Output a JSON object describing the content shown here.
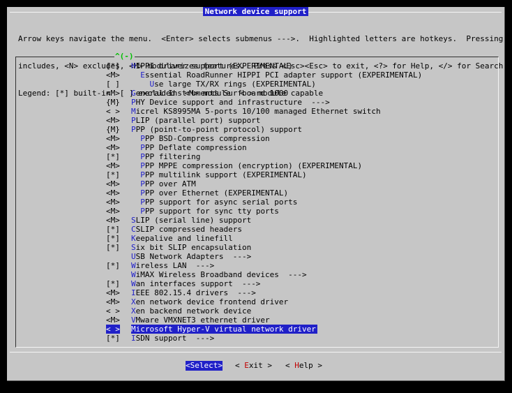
{
  "title": "Network device support",
  "help": [
    "Arrow keys navigate the menu.  <Enter> selects submenus --->.  Highlighted letters are hotkeys.  Pressing <Y>",
    "includes, <N> excludes, <M> modularizes features.  Press <Esc><Esc> to exit, <?> for Help, </> for Search.",
    "Legend: [*] built-in  [ ] excluded  <M> module  < > module capable"
  ],
  "scroll_indicator": "^(-)",
  "items": [
    {
      "tag": "[*]",
      "indent": "",
      "hotkey": "H",
      "rest": "IPPI driver support (EXPERIMENTAL)"
    },
    {
      "tag": "<M>",
      "indent": "  ",
      "hotkey": "E",
      "rest": "ssential RoadRunner HIPPI PCI adapter support (EXPERIMENTAL)"
    },
    {
      "tag": "[ ]",
      "indent": "    ",
      "hotkey": "U",
      "rest": "se large TX/RX rings (EXPERIMENTAL)"
    },
    {
      "tag": "<M>",
      "indent": "",
      "hotkey": "G",
      "rest": "eneral Instruments Surfboard 1000"
    },
    {
      "tag": "{M}",
      "indent": "",
      "hotkey": "P",
      "rest": "HY Device support and infrastructure  --->"
    },
    {
      "tag": "< >",
      "indent": "",
      "hotkey": "M",
      "rest": "icrel KS8995MA 5-ports 10/100 managed Ethernet switch"
    },
    {
      "tag": "<M>",
      "indent": "",
      "hotkey": "P",
      "rest": "LIP (parallel port) support"
    },
    {
      "tag": "{M}",
      "indent": "",
      "hotkey": "P",
      "rest": "PP (point-to-point protocol) support"
    },
    {
      "tag": "<M>",
      "indent": "  ",
      "hotkey": "P",
      "rest": "PP BSD-Compress compression"
    },
    {
      "tag": "<M>",
      "indent": "  ",
      "hotkey": "P",
      "rest": "PP Deflate compression"
    },
    {
      "tag": "[*]",
      "indent": "  ",
      "hotkey": "P",
      "rest": "PP filtering"
    },
    {
      "tag": "<M>",
      "indent": "  ",
      "hotkey": "P",
      "rest": "PP MPPE compression (encryption) (EXPERIMENTAL)"
    },
    {
      "tag": "[*]",
      "indent": "  ",
      "hotkey": "P",
      "rest": "PP multilink support (EXPERIMENTAL)"
    },
    {
      "tag": "<M>",
      "indent": "  ",
      "hotkey": "P",
      "rest": "PP over ATM"
    },
    {
      "tag": "<M>",
      "indent": "  ",
      "hotkey": "P",
      "rest": "PP over Ethernet (EXPERIMENTAL)"
    },
    {
      "tag": "<M>",
      "indent": "  ",
      "hotkey": "P",
      "rest": "PP support for async serial ports"
    },
    {
      "tag": "<M>",
      "indent": "  ",
      "hotkey": "P",
      "rest": "PP support for sync tty ports"
    },
    {
      "tag": "<M>",
      "indent": "",
      "hotkey": "S",
      "rest": "LIP (serial line) support"
    },
    {
      "tag": "[*]",
      "indent": "",
      "hotkey": "C",
      "rest": "SLIP compressed headers"
    },
    {
      "tag": "[*]",
      "indent": "",
      "hotkey": "K",
      "rest": "eepalive and linefill"
    },
    {
      "tag": "[*]",
      "indent": "",
      "hotkey": "S",
      "rest": "ix bit SLIP encapsulation"
    },
    {
      "tag": "",
      "indent": "",
      "hotkey": "U",
      "rest": "SB Network Adapters  --->"
    },
    {
      "tag": "[*]",
      "indent": "",
      "hotkey": "W",
      "rest": "ireless LAN  --->"
    },
    {
      "tag": "",
      "indent": "",
      "hotkey": "W",
      "rest": "iMAX Wireless Broadband devices  --->"
    },
    {
      "tag": "[*]",
      "indent": "",
      "hotkey": "W",
      "rest": "an interfaces support  --->"
    },
    {
      "tag": "<M>",
      "indent": "",
      "hotkey": "I",
      "rest": "EEE 802.15.4 drivers  --->"
    },
    {
      "tag": "<M>",
      "indent": "",
      "hotkey": "X",
      "rest": "en network device frontend driver"
    },
    {
      "tag": "< >",
      "indent": "",
      "hotkey": "X",
      "rest": "en backend network device"
    },
    {
      "tag": "<M>",
      "indent": "",
      "hotkey": "V",
      "rest": "Mware VMXNET3 ethernet driver"
    },
    {
      "tag": "< >",
      "indent": "",
      "hotkey": "M",
      "rest": "icrosoft Hyper-V virtual network driver",
      "selected": true
    },
    {
      "tag": "[*]",
      "indent": "",
      "hotkey": "I",
      "rest": "SDN support  --->"
    }
  ],
  "buttons": [
    {
      "pre": "<",
      "hotkey": "S",
      "rest": "elect>",
      "active": true
    },
    {
      "pre": "< ",
      "hotkey": "E",
      "rest": "xit >",
      "active": false
    },
    {
      "pre": "< ",
      "hotkey": "H",
      "rest": "elp >",
      "active": false
    }
  ],
  "colors": {
    "dialog_bg": "#c6c6c6",
    "screen_bg": "#000000",
    "title_bg": "#2020c8",
    "hotkey": "#2020c8",
    "button_hotkey": "#c00000",
    "scroll_indicator": "#00c000"
  }
}
